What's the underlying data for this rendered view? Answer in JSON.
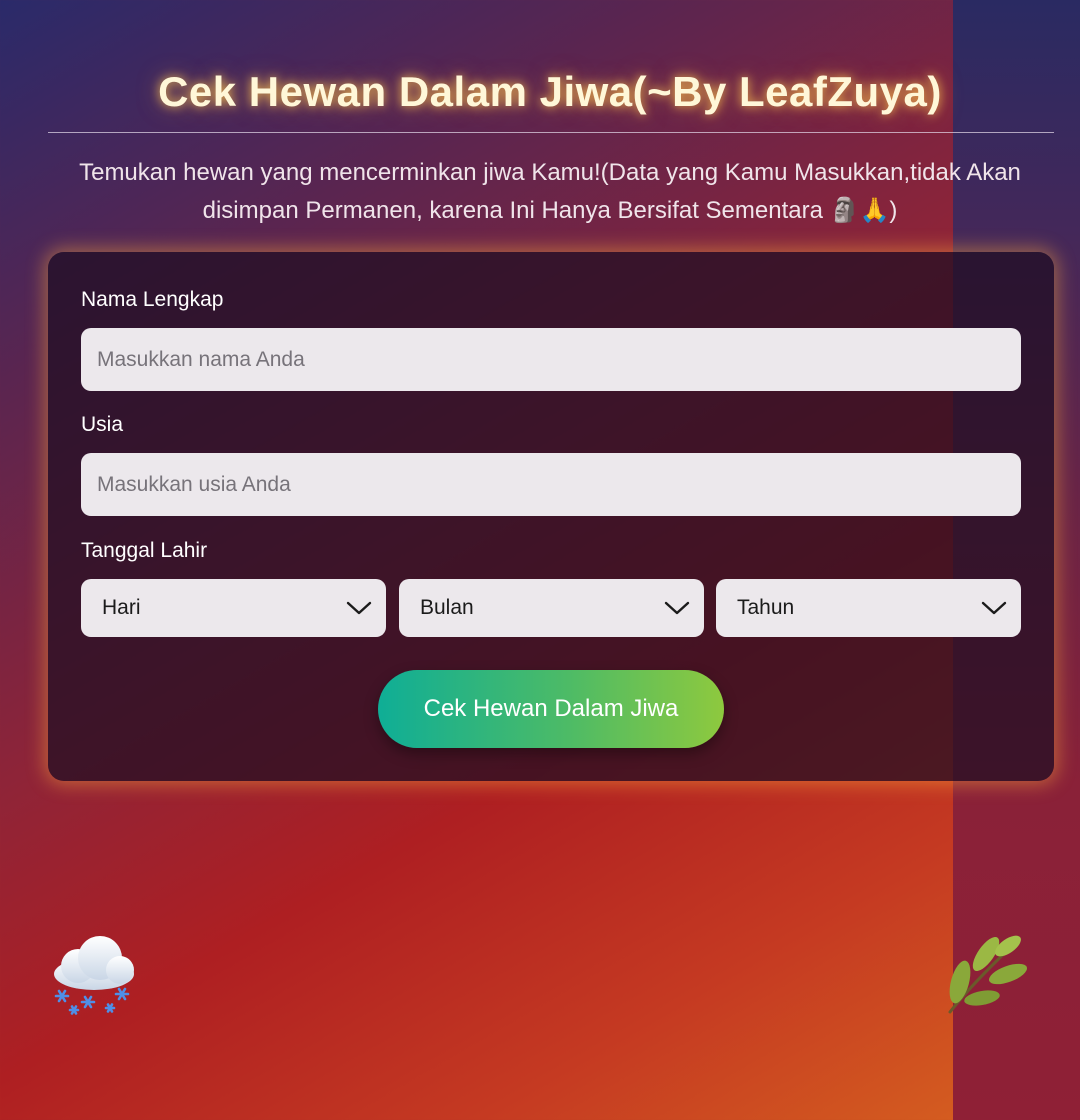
{
  "header": {
    "title": "Cek Hewan Dalam Jiwa(~By LeafZuya)",
    "subtitle": "Temukan hewan yang mencerminkan jiwa Kamu!(Data yang Kamu Masukkan,tidak Akan disimpan Permanen, karena Ini Hanya Bersifat Sementara 🗿🙏)"
  },
  "form": {
    "name": {
      "label": "Nama Lengkap",
      "placeholder": "Masukkan nama Anda"
    },
    "age": {
      "label": "Usia",
      "placeholder": "Masukkan usia Anda"
    },
    "birthdate": {
      "label": "Tanggal Lahir",
      "day": "Hari",
      "month": "Bulan",
      "year": "Tahun"
    },
    "submit_label": "Cek Hewan Dalam Jiwa"
  },
  "decorations": {
    "left_icon": "snow-cloud-icon",
    "right_icon": "leaf-icon"
  },
  "colors": {
    "button_start": "#0fae96",
    "button_end": "#8ec93e",
    "title_glow": "#ffb84d"
  }
}
